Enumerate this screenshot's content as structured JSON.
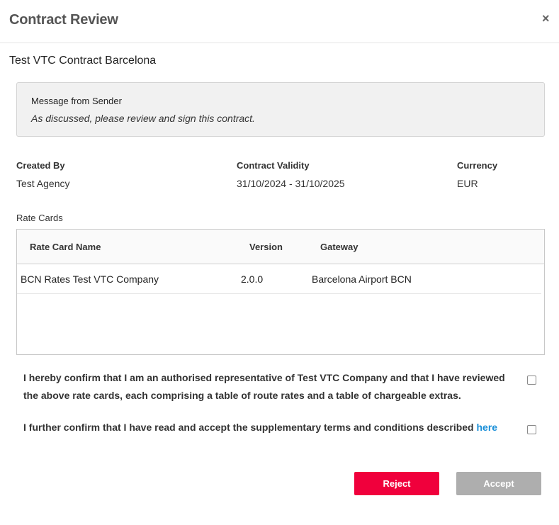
{
  "modal": {
    "title": "Contract Review",
    "close_glyph": "×",
    "close_icon": "close-icon"
  },
  "contract": {
    "name": "Test VTC Contract Barcelona"
  },
  "message": {
    "label": "Message from Sender",
    "text": "As discussed, please review and sign this contract."
  },
  "details": {
    "created_by_label": "Created By",
    "created_by_value": "Test Agency",
    "validity_label": "Contract Validity",
    "validity_value": "31/10/2024 - 31/10/2025",
    "currency_label": "Currency",
    "currency_value": "EUR"
  },
  "rate_cards": {
    "label": "Rate Cards",
    "columns": [
      "Rate Card Name",
      "Version",
      "Gateway"
    ],
    "rows": [
      {
        "name": "BCN Rates Test VTC Company",
        "version": "2.0.0",
        "gateway": "Barcelona Airport BCN"
      }
    ]
  },
  "confirmations": {
    "first_text": "I hereby confirm that I am an authorised representative of Test VTC Company and that I have reviewed the above rate cards, each comprising a table of route rates and a table of chargeable extras.",
    "first_checked": false,
    "second_text": "I further confirm that I have read and accept the supplementary terms and conditions described ",
    "second_link": "here",
    "second_checked": false
  },
  "actions": {
    "reject_label": "Reject",
    "accept_label": "Accept"
  },
  "colors": {
    "reject": "#f0003c",
    "accept_disabled": "#aeaeae",
    "link": "#1a8fd8"
  }
}
